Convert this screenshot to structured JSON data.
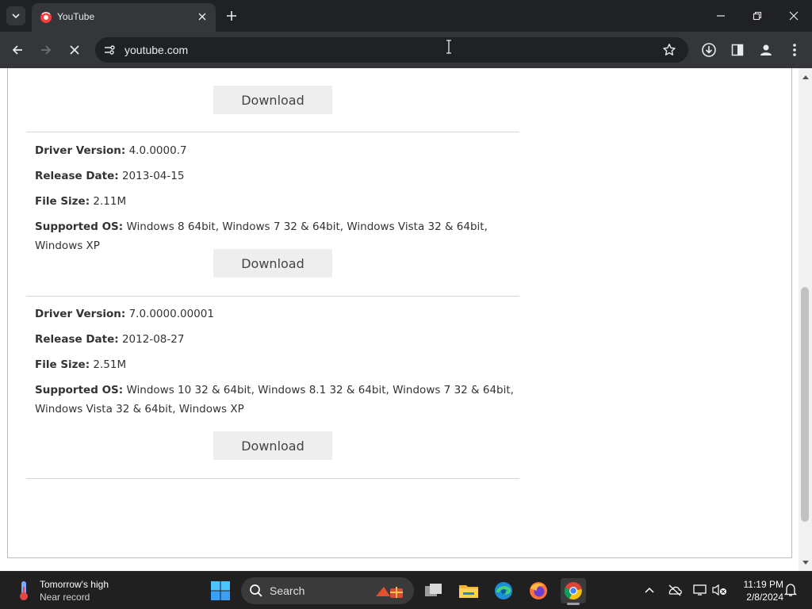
{
  "browser": {
    "tab_title": "YouTube",
    "url": "youtube.com"
  },
  "page": {
    "download_label": "Download",
    "drivers": [
      {
        "version_label": "Driver Version:",
        "version": "4.0.0000.7",
        "date_label": "Release Date:",
        "date": "2013-04-15",
        "size_label": "File Size:",
        "size": "2.11M",
        "os_label": "Supported OS:",
        "os": "Windows 8 64bit, Windows 7 32 & 64bit, Windows Vista 32 & 64bit, Windows XP"
      },
      {
        "version_label": "Driver Version:",
        "version": "7.0.0000.00001",
        "date_label": "Release Date:",
        "date": "2012-08-27",
        "size_label": "File Size:",
        "size": "2.51M",
        "os_label": "Supported OS:",
        "os": "Windows 10 32 & 64bit, Windows 8.1 32 & 64bit, Windows 7 32 & 64bit, Windows Vista 32 & 64bit, Windows XP"
      }
    ]
  },
  "taskbar": {
    "weather_line1": "Tomorrow's high",
    "weather_line2": "Near record",
    "search_placeholder": "Search",
    "time": "11:19 PM",
    "date": "2/8/2024"
  },
  "colors": {
    "chrome_dark": "#202124",
    "chrome_toolbar": "#35363a",
    "download_bg": "#eeeeee",
    "taskbar": "#202020"
  }
}
